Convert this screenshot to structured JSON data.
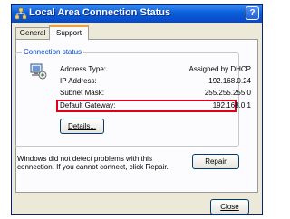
{
  "window": {
    "title": "Local Area Connection Status",
    "help_label": "?"
  },
  "tabs": [
    {
      "label": "General"
    },
    {
      "label": "Support"
    }
  ],
  "connection_status": {
    "group_label": "Connection status",
    "rows": [
      {
        "label": "Address Type:",
        "value": "Assigned by DHCP"
      },
      {
        "label": "IP Address:",
        "value": "192.168.0.24"
      },
      {
        "label": "Subnet Mask:",
        "value": "255.255.255.0"
      },
      {
        "label": "Default Gateway:",
        "value": "192.168.0.1"
      }
    ],
    "details_label": "Details..."
  },
  "message": "Windows did not detect problems with this connection. If you cannot connect, click Repair.",
  "repair_label": "Repair",
  "close_label": "Close",
  "highlight_color": "#e0001b",
  "title_color": "#0a5fd8"
}
